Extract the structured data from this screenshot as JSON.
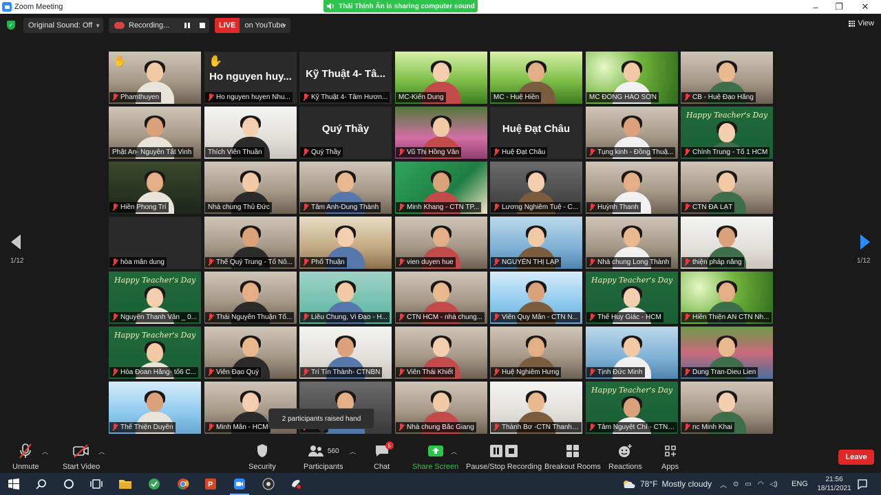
{
  "window": {
    "title": "Zoom Meeting",
    "minimize": "–",
    "maximize": "❐",
    "close": "✕"
  },
  "share_banner": {
    "text": "Thái Thịnh Ân is sharing computer sound",
    "icon": "speaker-icon"
  },
  "topbar": {
    "original_sound": "Original Sound: Off",
    "recording": "Recording...",
    "live": "LIVE",
    "live_target": "on YouTube",
    "view": "View"
  },
  "pager": {
    "left": "1/12",
    "right": "1/12"
  },
  "colors": {
    "accent": "#2d8cff",
    "danger": "#e02828",
    "share_green": "#2ec44b",
    "active_speaker": "#e6e36a"
  },
  "tiles": [
    {
      "name": "Phamthuyen",
      "kind": "video",
      "scene": "room",
      "hand": true
    },
    {
      "name": "Ho nguyen huyen Nhu...",
      "kind": "label",
      "label": "Ho nguyen huy...",
      "hand": true
    },
    {
      "name": "Kỹ Thuật 4- Tâm Hươn...",
      "kind": "label",
      "label": "Kỹ Thuật 4- Tâ..."
    },
    {
      "name": "MC-Kiến Dung",
      "kind": "video",
      "scene": "field",
      "active": true,
      "muted": false
    },
    {
      "name": "MC - Huệ Hiền",
      "kind": "video",
      "scene": "field",
      "muted": false
    },
    {
      "name": "MC ĐỒNG HẢO SƠN",
      "kind": "video",
      "scene": "green",
      "muted": false
    },
    {
      "name": "CB - Huệ Đạo Hằng",
      "kind": "video",
      "scene": "room"
    },
    {
      "name": "Phật An- Nguyễn Tất Vinh",
      "kind": "video",
      "scene": "room",
      "muted": false
    },
    {
      "name": "Thích Viên Thuần",
      "kind": "video",
      "scene": "light",
      "muted": false
    },
    {
      "name": "Quý Thầy",
      "kind": "label",
      "label": "Quý Thầy"
    },
    {
      "name": "Vũ Thị Hồng Vân",
      "kind": "video",
      "scene": "lotus"
    },
    {
      "name": "Huệ Đạt Châu",
      "kind": "label",
      "label": "Huệ Đạt Châu"
    },
    {
      "name": "Tụng kinh - Đồng Thuậ...",
      "kind": "video",
      "scene": "room"
    },
    {
      "name": "Chính Trung - Tổ 1 HCM",
      "kind": "video",
      "scene": "board",
      "board": "Happy Teacher's Day"
    },
    {
      "name": "Hiền Phong Trí",
      "kind": "video",
      "scene": "dark"
    },
    {
      "name": "Nhà chung Thủ Đức",
      "kind": "video",
      "scene": "room",
      "muted": false
    },
    {
      "name": "Tâm Anh-Dung Thành",
      "kind": "video",
      "scene": "room"
    },
    {
      "name": "Minh Khang - CTN TP...",
      "kind": "video",
      "scene": "poster"
    },
    {
      "name": "Lương Nghiêm Tuệ - C...",
      "kind": "video",
      "scene": "dim"
    },
    {
      "name": "Huỳnh Thanh",
      "kind": "video",
      "scene": "room"
    },
    {
      "name": "CTN ĐÀ LẠT",
      "kind": "video",
      "scene": "room"
    },
    {
      "name": "hòa mẫn dung",
      "kind": "blank"
    },
    {
      "name": "Thế Quý Trung - Tổ Nô...",
      "kind": "video",
      "scene": "room"
    },
    {
      "name": "Phổ Thuận",
      "kind": "video",
      "scene": "shelf"
    },
    {
      "name": "vien duyen hue",
      "kind": "video",
      "scene": "room"
    },
    {
      "name": "NGUYỄN THỊ LẠP",
      "kind": "video",
      "scene": "blue"
    },
    {
      "name": "Nhà chung Long Thành",
      "kind": "video",
      "scene": "room"
    },
    {
      "name": "thiện pháp năng",
      "kind": "video",
      "scene": "light"
    },
    {
      "name": "Nguyễn Thanh Vân _ 0...",
      "kind": "video",
      "scene": "board",
      "board": "Happy Teacher's Day"
    },
    {
      "name": "Thái Nguyễn Thuận Tố...",
      "kind": "video",
      "scene": "room"
    },
    {
      "name": "Liễu Chung, Vi Đạo - H...",
      "kind": "video",
      "scene": "teal"
    },
    {
      "name": "CTN HCM - nhà chung...",
      "kind": "video",
      "scene": "room"
    },
    {
      "name": "Viên Quy Mẫn - CTN N...",
      "kind": "video",
      "scene": "sky"
    },
    {
      "name": "Thế Huy Giác - HCM",
      "kind": "video",
      "scene": "board",
      "board": "Happy Teacher's Day"
    },
    {
      "name": "Hiền Thiện AN CTN Nh...",
      "kind": "video",
      "scene": "green"
    },
    {
      "name": "Hòa Đoan Hằng- tổ6 C...",
      "kind": "video",
      "scene": "board",
      "board": "Happy Teacher's Day"
    },
    {
      "name": "Viên Đạo Quý",
      "kind": "video",
      "scene": "room"
    },
    {
      "name": "Trí Tín Thành- CTNBN",
      "kind": "video",
      "scene": "light"
    },
    {
      "name": "Viên Thái Khiết",
      "kind": "video",
      "scene": "room"
    },
    {
      "name": "Huệ Nghiêm Hưng",
      "kind": "video",
      "scene": "room"
    },
    {
      "name": "Tịnh Đức Minh",
      "kind": "video",
      "scene": "blue"
    },
    {
      "name": "Dung Tran-Dieu Lien",
      "kind": "video",
      "scene": "park"
    },
    {
      "name": "Thế Thiện Duyên",
      "kind": "video",
      "scene": "sky"
    },
    {
      "name": "Minh Mẫn - HCM",
      "kind": "video",
      "scene": "room"
    },
    {
      "name": "...T...",
      "kind": "video",
      "scene": "dim"
    },
    {
      "name": "Nhà chung Bắc Giang",
      "kind": "video",
      "scene": "room"
    },
    {
      "name": "Thành Bơ -CTN Thanh ...",
      "kind": "video",
      "scene": "light"
    },
    {
      "name": "Tâm Nguyệt Chí - CTN ...",
      "kind": "video",
      "scene": "board",
      "board": "Happy Teacher's Day"
    },
    {
      "name": "nc Minh Khai",
      "kind": "video",
      "scene": "room"
    }
  ],
  "tooltip": {
    "text": "2 participants raised hand"
  },
  "toolbar": {
    "unmute": "Unmute",
    "start_video": "Start Video",
    "security": "Security",
    "participants": "Participants",
    "participants_count": "560",
    "chat": "Chat",
    "chat_badge": "5",
    "share_screen": "Share Screen",
    "record": "Pause/Stop Recording",
    "breakout": "Breakout Rooms",
    "reactions": "Reactions",
    "apps": "Apps",
    "leave": "Leave"
  },
  "taskbar": {
    "weather_temp": "78°F",
    "weather_text": "Mostly cloudy",
    "lang": "ENG",
    "time": "21:56",
    "date": "18/11/2021"
  }
}
